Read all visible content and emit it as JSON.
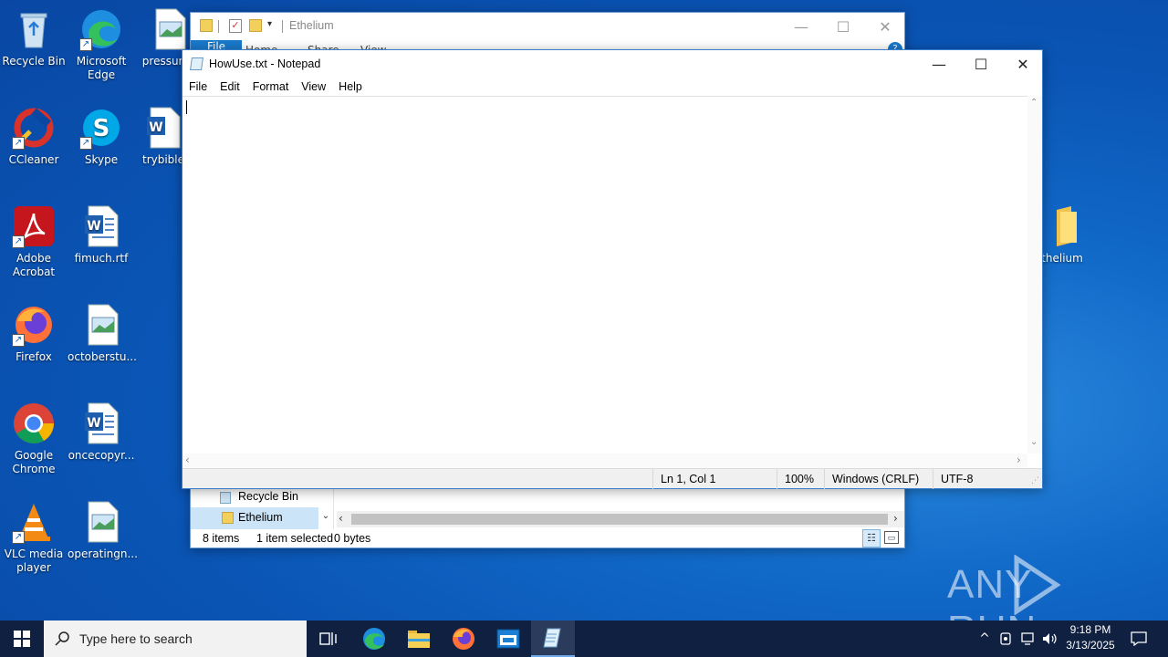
{
  "desktop": {
    "icons": [
      {
        "label": "Recycle Bin"
      },
      {
        "label": "Microsoft Edge"
      },
      {
        "label": "pressurec"
      },
      {
        "label": "CCleaner"
      },
      {
        "label": "Skype"
      },
      {
        "label": "trybible"
      },
      {
        "label": "Adobe Acrobat"
      },
      {
        "label": "fimuch.rtf"
      },
      {
        "label": "Firefox"
      },
      {
        "label": "octoberstu..."
      },
      {
        "label": "Google Chrome"
      },
      {
        "label": "oncecopyr..."
      },
      {
        "label": "VLC media player"
      },
      {
        "label": "operatingn..."
      },
      {
        "label": "thelium"
      }
    ],
    "watermark": "ANY RUN"
  },
  "explorer": {
    "title": "Ethelium",
    "tabs": [
      "File",
      "Home",
      "Share",
      "View"
    ],
    "nav": [
      "Recycle Bin",
      "Ethelium"
    ],
    "status": {
      "items": "8 items",
      "selected": "1 item selected",
      "size": "0 bytes"
    }
  },
  "notepad": {
    "title": "HowUse.txt - Notepad",
    "menu": [
      "File",
      "Edit",
      "Format",
      "View",
      "Help"
    ],
    "content": "",
    "status": {
      "position": "Ln 1, Col 1",
      "zoom": "100%",
      "line_ending": "Windows (CRLF)",
      "encoding": "UTF-8"
    }
  },
  "taskbar": {
    "search_placeholder": "Type here to search",
    "time": "9:18 PM",
    "date": "3/13/2025"
  }
}
